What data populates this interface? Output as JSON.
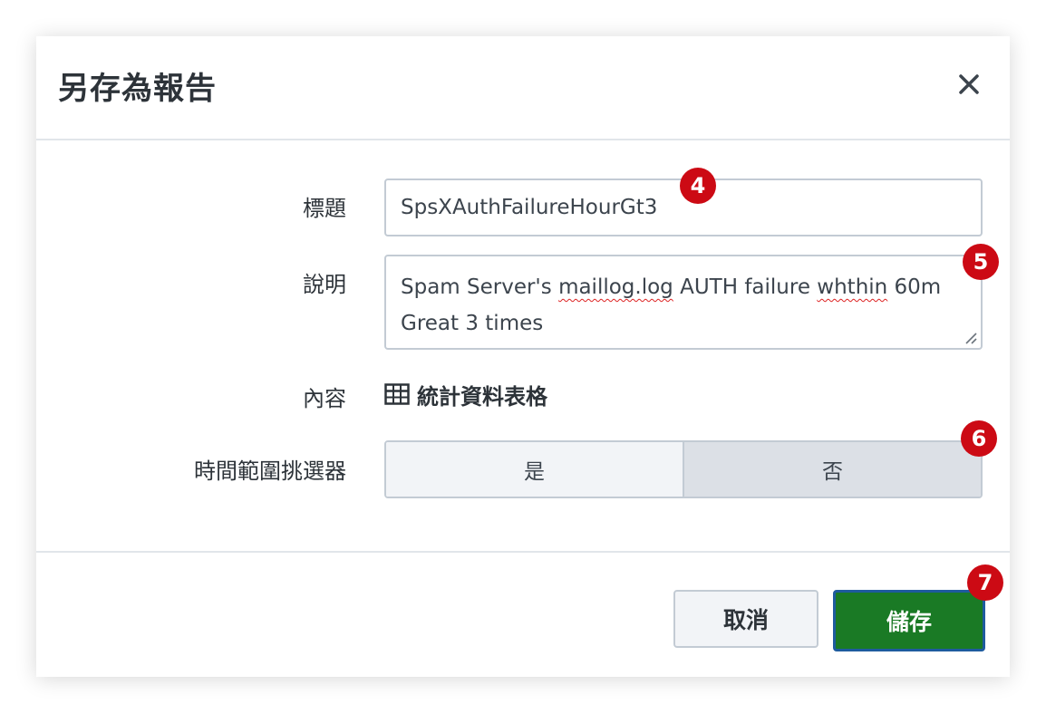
{
  "dialog": {
    "title": "另存為報告"
  },
  "form": {
    "title_label": "標題",
    "title_value": "SpsXAuthFailureHourGt3",
    "description_label": "說明",
    "description_parts": [
      "Spam Server's ",
      "maillog.log",
      " AUTH failure ",
      "whthin",
      " 60m Great 3 times"
    ],
    "content_label": "內容",
    "content_value": "統計資料表格",
    "time_picker_label": "時間範圍挑選器",
    "time_picker_options": [
      "是",
      "否"
    ],
    "time_picker_selected": "否"
  },
  "footer": {
    "cancel_label": "取消",
    "save_label": "儲存"
  },
  "annotations": [
    "4",
    "5",
    "6",
    "7"
  ],
  "icons": {
    "close": "close-icon",
    "content": "table-icon",
    "resize": "resize-grip-icon"
  },
  "colors": {
    "save_bg": "#1a7a25",
    "save_border": "#1e5b9e",
    "badge": "#cc0a14",
    "selected_toggle": "#dce0e6"
  }
}
